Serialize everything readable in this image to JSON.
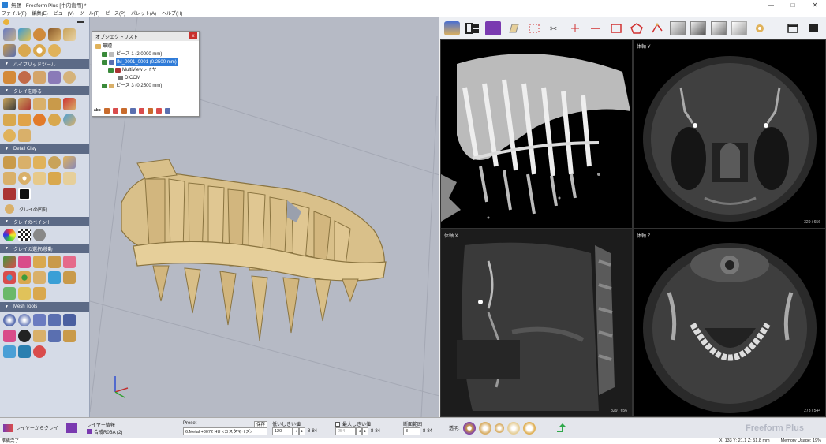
{
  "window": {
    "title": "無題 - Freeform Plus [中内歯用] *",
    "controls": [
      "—",
      "□",
      "✕"
    ]
  },
  "menu": [
    "ファイル(F)",
    "編集(E)",
    "ビュー(V)",
    "ツール(T)",
    "ピース(P)",
    "パレット(A)",
    "ヘルプ(H)"
  ],
  "palette": {
    "sections": [
      {
        "label": "ハイブリッドツール"
      },
      {
        "label": "クレイを彫る"
      },
      {
        "label": "Detail Clay"
      },
      {
        "label": "クレイのペイント"
      },
      {
        "label": "クレイの選択/移動"
      },
      {
        "label": "Mesh Tools"
      }
    ],
    "clay_emboss_label": "クレイの凹刻"
  },
  "object_list": {
    "title": "オブジェクトリスト",
    "close": "x",
    "root": "無題",
    "items": [
      {
        "label": "ピース 1 (2.0000 mm)"
      },
      {
        "label": "IM_0001_0001 (0.2500 mm)"
      },
      {
        "label": "MultiViewレイヤー"
      },
      {
        "label": "DICOM"
      },
      {
        "label": "ピース 3 (0.2500 mm)"
      }
    ]
  },
  "ct_views": {
    "axial_label": "体軸 Y",
    "sagittal_label": "体軸 X",
    "coronal_label": "体軸 Z",
    "axial_count": "329 / 656",
    "sagittal_count": "329 / 656",
    "coronal_count": "273 / 544"
  },
  "bottom": {
    "layer_to_clay": "レイヤーからクレイ",
    "layer_info_label": "レイヤー情報",
    "layer_info_value": "合成R0BA (2)",
    "preset_label": "Preset",
    "save_label": "保存",
    "preset_value": "6.Metal +3072 HU <カスタマイズ>",
    "low_threshold_label": "低いしきい値",
    "low_threshold_value": "120",
    "low_range": "8-84",
    "high_threshold_label": "最大しきい値",
    "high_threshold_value": "254",
    "high_range": "8-84",
    "slice_label": "断面範囲",
    "slice_value": "3",
    "slice_range": "8-84",
    "transparency_label": "透明:",
    "brand": "Freeform Plus"
  },
  "status": {
    "left": "準備完了",
    "coords": "X: 133   Y: 21.1   Z: 51.8   mm",
    "memory": "Memory Usage: 19%"
  },
  "colors": {
    "palette_bg": "#d5dbe7",
    "section_header": "#5c6a86",
    "viewport_bg": "#b6bac5",
    "tooth": "#d9c08a",
    "selection": "#2f7bd8"
  }
}
